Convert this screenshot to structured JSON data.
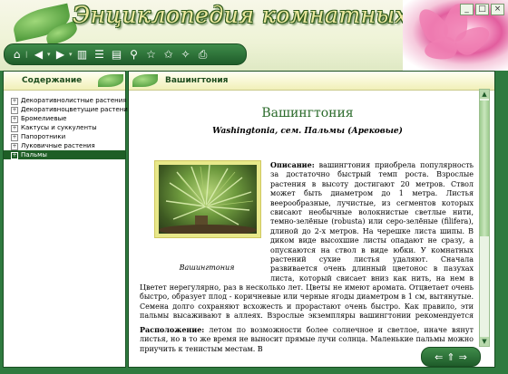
{
  "app": {
    "title": "Энциклопедия комнатных растений",
    "window_controls": [
      "_",
      "□",
      "×"
    ]
  },
  "toolbar": {
    "icons": [
      "home-icon",
      "back-icon",
      "forward-icon",
      "library-icon",
      "list-icon",
      "search-icon",
      "favorite-icon",
      "add-favorite-icon",
      "remove-favorite-icon",
      "print-icon"
    ]
  },
  "sidebar": {
    "header": "Содержание",
    "items": [
      {
        "label": "Декоративнолистные растения",
        "expander": "+"
      },
      {
        "label": "Декоративноцветущие растения",
        "expander": "+"
      },
      {
        "label": "Бромелиевые",
        "expander": "+"
      },
      {
        "label": "Кактусы и суккуленты",
        "expander": "+"
      },
      {
        "label": "Папоротники",
        "expander": "+"
      },
      {
        "label": "Луковичные растения",
        "expander": "+"
      },
      {
        "label": "Пальмы",
        "expander": "+",
        "selected": true
      }
    ]
  },
  "article": {
    "header": "Вашингтония",
    "title": "Вашингтония",
    "subtitle": "Washingtonia, сем. Пальмы (Арековые)",
    "photo_caption": "Вашингтония",
    "description_label": "Описание:",
    "description_text": "вашингтония приобрела популярность за достаточно быстрый темп роста. Взрослые растения в высоту достигают 20 метров. Ствол может быть диаметром до 1 метра. Листья веерообразные, лучистые, из сегментов которых свисают необычные волокнистые светлые нити, темно-зелёные (robusta) или серо-зелёные (filifera), длиной до 2-х метров. На черешке листа шипы. В диком виде высохшие листы опадают не сразу, а опускаются на ствол в виде юбки. У комнатных растений сухие листья удаляют. Сначала развивается очень длинный цветонос в пазухах листа, который свисает вниз как нить, на нем в большом количестве развиваются колокольчатые белые цветки. Цветет нерегулярно, раз в несколько лет. Цветы не имеют аромата. Отцветает очень быстро, образует плод - коричневые или черные ягоды диаметром в 1 см, вытянутые. Семена долго сохраняют всхожесть и прорастают очень быстро. Как правило, эти пальмы высаживают в аллеях. Взрослые экземпляры вашингтонии рекомендуется содержать на открытом воздухе в деревянных кадках.",
    "location_label": "Расположение:",
    "location_text": "летом по возможности более солнечное и светлое, иначе вянут листья, но в то же время не выносит прямые лучи солнца. Маленькие пальмы можно приучить к тенистым местам. В"
  },
  "navigation": {
    "prev": "⇐",
    "up": "⇑",
    "next": "⇒"
  }
}
